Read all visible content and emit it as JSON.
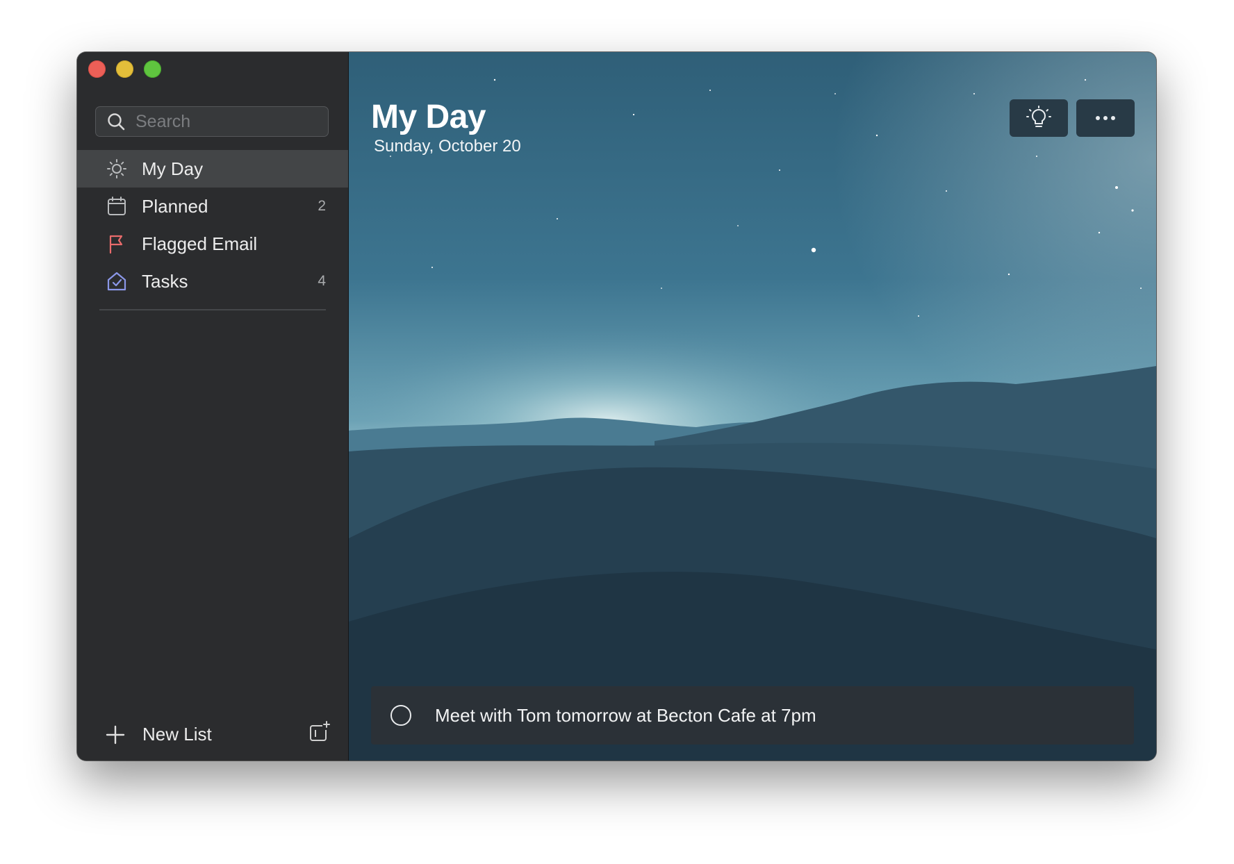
{
  "window": {
    "traffic_lights": {
      "close": "#ec5f57",
      "minimize": "#e3be3a",
      "zoom": "#5fc43f"
    }
  },
  "sidebar": {
    "search": {
      "placeholder": "Search",
      "value": ""
    },
    "items": [
      {
        "label": "My Day",
        "count": "",
        "icon": "sun-icon",
        "color": "#b9bbbd",
        "active": true
      },
      {
        "label": "Planned",
        "count": "2",
        "icon": "calendar-icon",
        "color": "#b9bbbd",
        "active": false
      },
      {
        "label": "Flagged Email",
        "count": "",
        "icon": "flag-icon",
        "color": "#e96b6b",
        "active": false
      },
      {
        "label": "Tasks",
        "count": "4",
        "icon": "home-check-icon",
        "color": "#8b97e8",
        "active": false
      }
    ],
    "new_list_label": "New List",
    "new_group_icon": "new-group-icon"
  },
  "main": {
    "title": "My Day",
    "date": "Sunday, October 20",
    "buttons": {
      "suggestions_icon": "lightbulb-icon",
      "more_icon": "more-icon"
    },
    "task": {
      "title": "Meet with Tom tomorrow at Becton Cafe at 7pm"
    }
  }
}
